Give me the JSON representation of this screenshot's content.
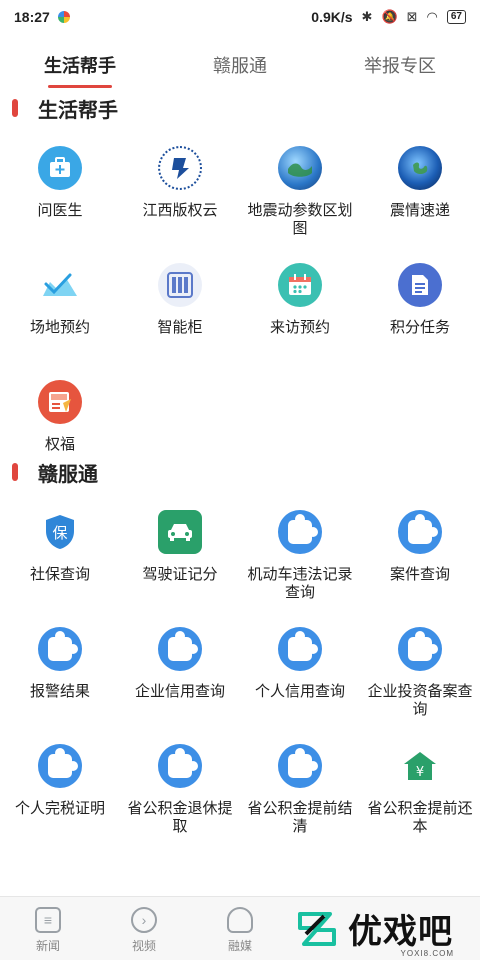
{
  "status": {
    "time": "18:27",
    "speed": "0.9K/s",
    "battery": "67"
  },
  "tabs": [
    {
      "label": "生活帮手"
    },
    {
      "label": "赣服通"
    },
    {
      "label": "举报专区"
    }
  ],
  "sections": [
    {
      "title": "生活帮手",
      "items": [
        {
          "label": "问医生",
          "icon": "medical-kit-icon"
        },
        {
          "label": "江西版权云",
          "icon": "copyright-cloud-logo-icon"
        },
        {
          "label": "地震动参数区划图",
          "icon": "globe-map-icon"
        },
        {
          "label": "震情速递",
          "icon": "earth-icon"
        },
        {
          "label": "场地预约",
          "icon": "venue-icon"
        },
        {
          "label": "智能柜",
          "icon": "locker-icon"
        },
        {
          "label": "来访预约",
          "icon": "calendar-icon"
        },
        {
          "label": "积分任务",
          "icon": "document-icon"
        },
        {
          "label": "权福",
          "icon": "news-icon"
        }
      ]
    },
    {
      "title": "赣服通",
      "items": [
        {
          "label": "社保查询",
          "icon": "shield-icon"
        },
        {
          "label": "驾驶证记分",
          "icon": "car-icon"
        },
        {
          "label": "机动车违法记录查询",
          "icon": "puzzle-icon"
        },
        {
          "label": "案件查询",
          "icon": "puzzle-icon"
        },
        {
          "label": "报警结果",
          "icon": "puzzle-icon"
        },
        {
          "label": "企业信用查询",
          "icon": "puzzle-icon"
        },
        {
          "label": "个人信用查询",
          "icon": "puzzle-icon"
        },
        {
          "label": "企业投资备案查询",
          "icon": "puzzle-icon"
        },
        {
          "label": "个人完税证明",
          "icon": "puzzle-icon"
        },
        {
          "label": "省公积金退休提取",
          "icon": "puzzle-icon"
        },
        {
          "label": "省公积金提前结清",
          "icon": "puzzle-icon"
        },
        {
          "label": "省公积金提前还本",
          "icon": "house-yuan-icon"
        }
      ]
    }
  ],
  "bottom_nav": [
    {
      "label": "新闻",
      "icon": "news-tab-icon"
    },
    {
      "label": "视频",
      "icon": "play-icon"
    },
    {
      "label": "融媒",
      "icon": "cloud-icon"
    }
  ],
  "watermark": {
    "text": "优戏吧",
    "sub": "YOXI8.COM"
  }
}
